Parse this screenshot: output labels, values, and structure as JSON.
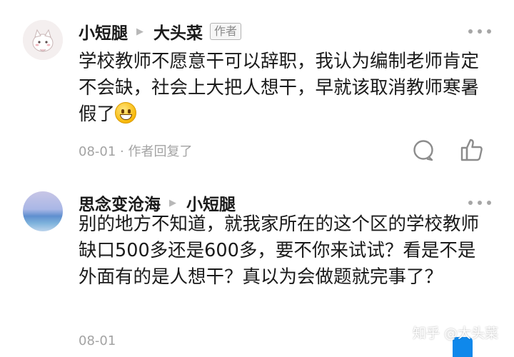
{
  "comments": [
    {
      "author": "小短腿",
      "reply_to": "大头菜",
      "badge": "作者",
      "text": "学校教师不愿意干可以辞职，我认为编制老师肯定不会缺，社会上大把人想干，早就该取消教师寒暑假了",
      "emoji": "grinning-face",
      "meta": "08-01 · 作者回复了"
    },
    {
      "author": "思念变沧海",
      "reply_to": "小短腿",
      "text": "别的地方不知道，就我家所在的这个区的学校教师缺口500多还是600多，要不你来试试？看是不是外面有的是人想干？真以为会做题就完事了？",
      "meta": "08-01"
    }
  ],
  "watermark": "知乎 @大头菜",
  "colors": {
    "text": "#1a1a1a",
    "meta": "#a3a3a3",
    "accent": "#0f88eb"
  }
}
